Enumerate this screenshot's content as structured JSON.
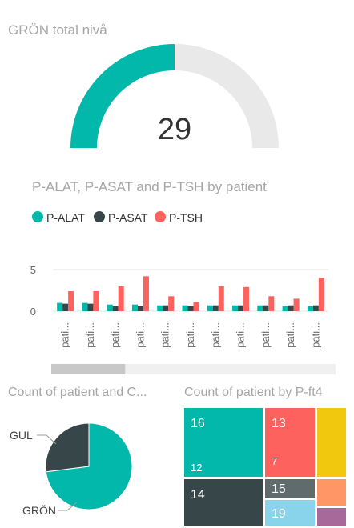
{
  "gauge": {
    "title": "GRÖN total nivå",
    "value": "29",
    "fill_fraction": 0.5,
    "fill_color": "#01b8aa",
    "track_color": "#e9e9e9"
  },
  "bar_chart": {
    "title": "P-ALAT, P-ASAT and P-TSH by patient",
    "legend": [
      "P-ALAT",
      "P-ASAT",
      "P-TSH"
    ],
    "scrollbar_thumb_fraction": 0.26
  },
  "pie": {
    "title": "Count of patient and C...",
    "labels": [
      "GUL",
      "GRÖN"
    ]
  },
  "treemap": {
    "title": "Count of patient by P-ft4",
    "tiles": [
      {
        "label": "16",
        "sub": "12",
        "color": "#01b8aa"
      },
      {
        "label": "13",
        "sub": "7",
        "color": "#fd625e"
      },
      {
        "label": "",
        "sub": "",
        "color": "#f2c80f"
      },
      {
        "label": "14",
        "sub": "",
        "color": "#374649"
      },
      {
        "label": "15",
        "sub": "",
        "color": "#5f6b6d"
      },
      {
        "label": "",
        "sub": "",
        "color": "#fe9666"
      },
      {
        "label": "19",
        "sub": "",
        "color": "#8ad4eb"
      },
      {
        "label": "",
        "sub": "",
        "color": "#a66999"
      }
    ]
  },
  "chart_data": [
    {
      "type": "bar",
      "title": "P-ALAT, P-ASAT and P-TSH by patient",
      "categories": [
        "pati...",
        "pati...",
        "pati...",
        "pati...",
        "pati...",
        "pati...",
        "pati...",
        "pati...",
        "pati...",
        "pati...",
        "pati..."
      ],
      "series": [
        {
          "name": "P-ALAT",
          "color": "#01b8aa",
          "values": [
            1.0,
            1.0,
            0.8,
            0.8,
            0.7,
            0.7,
            0.7,
            0.7,
            0.7,
            0.6,
            0.6
          ]
        },
        {
          "name": "P-ASAT",
          "color": "#374649",
          "values": [
            0.9,
            0.9,
            0.6,
            0.6,
            0.7,
            0.6,
            0.7,
            0.7,
            0.7,
            0.7,
            0.7
          ]
        },
        {
          "name": "P-TSH",
          "color": "#fd625e",
          "values": [
            2.4,
            2.4,
            3.0,
            4.2,
            1.8,
            1.1,
            3.0,
            2.9,
            1.8,
            1.5,
            4.0
          ]
        }
      ],
      "yticks": [
        0,
        5
      ],
      "ylim": [
        0,
        5.5
      ],
      "grid": true,
      "legend_position": "top-left"
    },
    {
      "type": "pie",
      "title": "Count of patient and C...",
      "labels": [
        "GUL",
        "GRÖN"
      ],
      "values": [
        27,
        73
      ],
      "colors": [
        "#374649",
        "#01b8aa"
      ]
    }
  ]
}
